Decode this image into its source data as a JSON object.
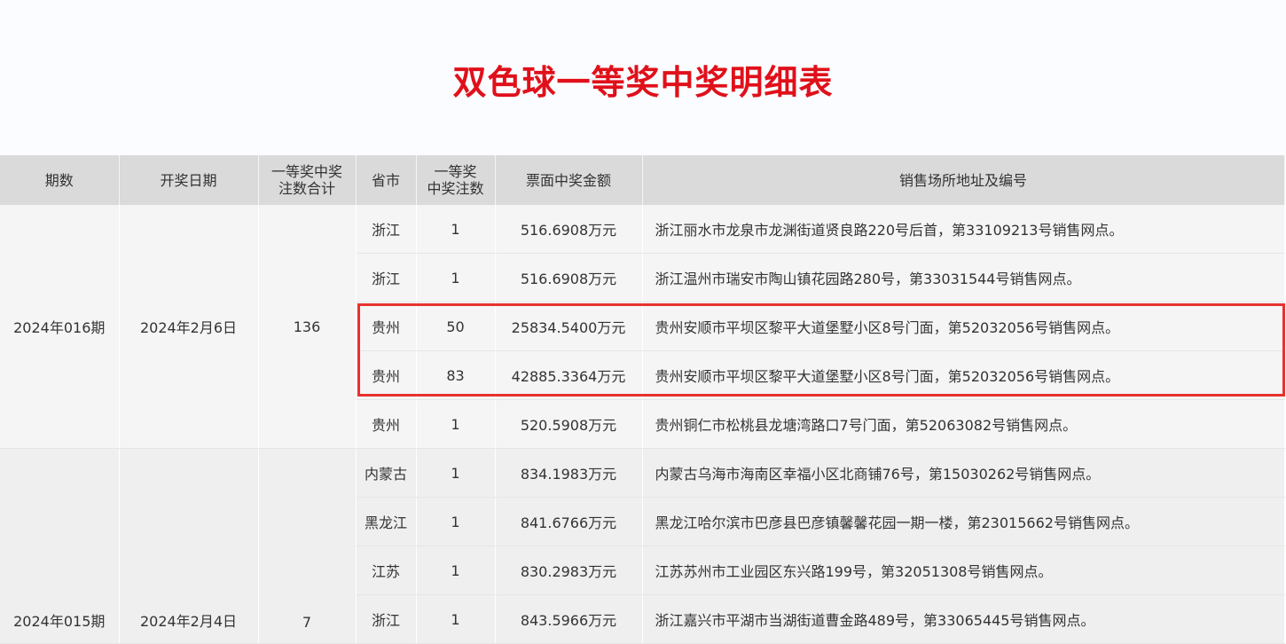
{
  "title": "双色球一等奖中奖明细表",
  "headers": [
    "期数",
    "开奖日期",
    "一等奖中奖注数合计",
    "省市",
    "一等奖中奖注数",
    "票面中奖金额",
    "销售场所地址及编号"
  ],
  "headers_display": {
    "period": "期数",
    "date": "开奖日期",
    "total_line1": "一等奖中奖",
    "total_line2": "注数合计",
    "province": "省市",
    "count_line1": "一等奖",
    "count_line2": "中奖注数",
    "amount": "票面中奖金额",
    "address": "销售场所地址及编号"
  },
  "periods": [
    {
      "period": "2024年016期",
      "date": "2024年2月6日",
      "total": "136",
      "rows": [
        {
          "province": "浙江",
          "count": "1",
          "amount": "516.6908万元",
          "address": "浙江丽水市龙泉市龙渊街道贤良路220号后首，第33109213号销售网点。"
        },
        {
          "province": "浙江",
          "count": "1",
          "amount": "516.6908万元",
          "address": "浙江温州市瑞安市陶山镇花园路280号，第33031544号销售网点。"
        },
        {
          "province": "贵州",
          "count": "50",
          "amount": "25834.5400万元",
          "address": "贵州安顺市平坝区黎平大道堡墅小区8号门面，第52032056号销售网点。"
        },
        {
          "province": "贵州",
          "count": "83",
          "amount": "42885.3364万元",
          "address": "贵州安顺市平坝区黎平大道堡墅小区8号门面，第52032056号销售网点。"
        },
        {
          "province": "贵州",
          "count": "1",
          "amount": "520.5908万元",
          "address": "贵州铜仁市松桃县龙塘湾路口7号门面，第52063082号销售网点。"
        }
      ]
    },
    {
      "period": "2024年015期",
      "date": "2024年2月4日",
      "total": "7",
      "rows": [
        {
          "province": "内蒙古",
          "count": "1",
          "amount": "834.1983万元",
          "address": "内蒙古乌海市海南区幸福小区北商铺76号，第15030262号销售网点。"
        },
        {
          "province": "黑龙江",
          "count": "1",
          "amount": "841.6766万元",
          "address": "黑龙江哈尔滨市巴彦县巴彦镇馨馨花园一期一楼，第23015662号销售网点。"
        },
        {
          "province": "江苏",
          "count": "1",
          "amount": "830.2983万元",
          "address": "江苏苏州市工业园区东兴路199号，第32051308号销售网点。"
        },
        {
          "province": "浙江",
          "count": "1",
          "amount": "843.5966万元",
          "address": "浙江嘉兴市平湖市当湖街道曹金路489号，第33065445号销售网点。"
        }
      ]
    }
  ],
  "highlight_color": "#e8322f",
  "title_color": "#e0101a"
}
